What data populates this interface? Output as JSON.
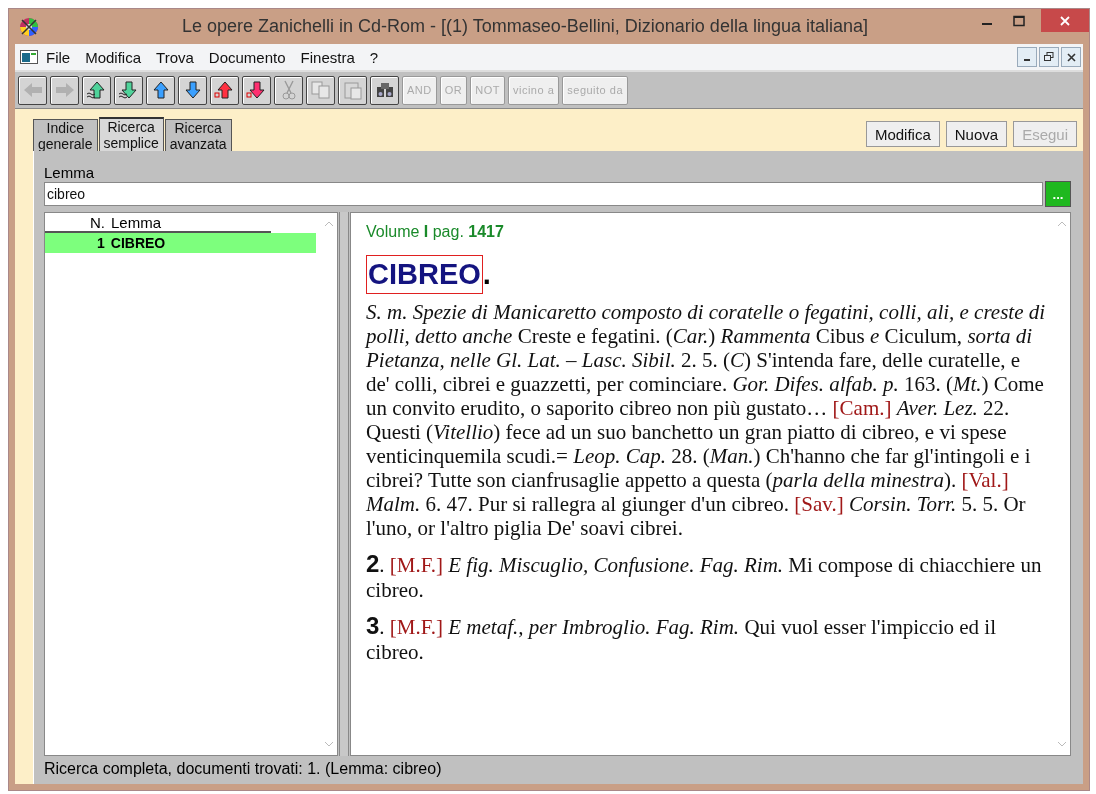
{
  "window": {
    "title": "Le opere Zanichelli in Cd-Rom - [(1) Tommaseo-Bellini, Dizionario della lingua italiana]"
  },
  "menu": [
    "File",
    "Modifica",
    "Trova",
    "Documento",
    "Finestra",
    "?"
  ],
  "toolbar": [
    {
      "kind": "back",
      "disabled": true
    },
    {
      "kind": "forward",
      "disabled": true
    },
    {
      "kind": "upwavy",
      "disabled": false
    },
    {
      "kind": "downwavy",
      "disabled": false
    },
    {
      "kind": "up",
      "disabled": false
    },
    {
      "kind": "down",
      "disabled": false
    },
    {
      "kind": "upred",
      "disabled": false
    },
    {
      "kind": "downred",
      "disabled": false
    },
    {
      "kind": "cut",
      "disabled": true
    },
    {
      "kind": "copy",
      "disabled": true
    },
    {
      "kind": "paste",
      "disabled": true
    },
    {
      "kind": "find",
      "disabled": false
    },
    {
      "kind": "text",
      "label": "AND",
      "disabled": true
    },
    {
      "kind": "text",
      "label": "OR",
      "disabled": true
    },
    {
      "kind": "text",
      "label": "NOT",
      "disabled": true
    },
    {
      "kind": "text",
      "label": "vicino a",
      "disabled": true
    },
    {
      "kind": "text",
      "label": "seguito da",
      "disabled": true
    }
  ],
  "tabs": [
    {
      "label": "Indice\ngenerale",
      "selected": false
    },
    {
      "label": "Ricerca\nsemplice",
      "selected": true
    },
    {
      "label": "Ricerca\navanzata",
      "selected": false
    }
  ],
  "actions": [
    {
      "label": "Modifica",
      "disabled": false
    },
    {
      "label": "Nuova",
      "disabled": false
    },
    {
      "label": "Esegui",
      "disabled": true
    }
  ],
  "lemma_field": {
    "label": "Lemma",
    "value": "cibreo",
    "button": "..."
  },
  "results": {
    "columns": [
      "N.",
      "Lemma"
    ],
    "rows": [
      {
        "n": "1",
        "lemma": "CIBREO",
        "selected": true
      }
    ]
  },
  "entry": {
    "volume": "Volume **I** pag. **1417**",
    "headword": "CIBREO",
    "headword_end": ".",
    "paragraphs": [
      [
        {
          "kind": "text",
          "text": "*S. m. Spezie di Manicaretto composto di coratelle o fegatini, colli, ali, e creste di polli, detto anche* Creste e fegatini. (*Car.*) *Rammenta* Cibus *e* Ciculum, *sorta di Pietanza, nelle Gl. Lat. – Lasc. Sibil.* 2. 5. (*C*) S'intenda fare, delle curatelle, e de' colli, cibrei e guazzetti, per cominciare. *Gor. Difes. alfab. p.* 163. (*Mt.*) Come un convito erudito, o saporito cibreo non più gustato… "
        },
        {
          "kind": "ref",
          "text": "[Cam.]"
        },
        {
          "kind": "text",
          "text": " *Aver. Lez.* 22. Questi (*Vitellio*) fece ad un suo banchetto un gran piatto di cibreo, e vi spese venticinquemila scudi.= *Leop. Cap.* 28. (*Man.*) Ch'hanno che far gl'intingoli e i cibrei? Tutte son cianfrusaglie appetto a questa (*parla della minestra*). "
        },
        {
          "kind": "ref",
          "text": "[Val.]"
        },
        {
          "kind": "text",
          "text": " *Malm.* 6. 47. Pur si rallegra al giunger d'un cibreo. "
        },
        {
          "kind": "ref",
          "text": "[Sav.]"
        },
        {
          "kind": "text",
          "text": " *Corsin. Torr.* 5. 5. Or l'uno, or l'altro piglia De' soavi cibrei."
        }
      ],
      [
        {
          "kind": "num",
          "text": "2"
        },
        {
          "kind": "text",
          "text": ". "
        },
        {
          "kind": "ref",
          "text": "[M.F.]"
        },
        {
          "kind": "text",
          "text": " *E fig. Miscuglio, Confusione. Fag. Rim.* Mi compose di chiacchiere un cibreo."
        }
      ],
      [
        {
          "kind": "num",
          "text": "3"
        },
        {
          "kind": "text",
          "text": ". "
        },
        {
          "kind": "ref",
          "text": "[M.F.]"
        },
        {
          "kind": "text",
          "text": " *E metaf., per Imbroglio. Fag. Rim.* Qui vuol esser l'impiccio ed il cibreo."
        }
      ]
    ]
  },
  "status_bar": "Ricerca completa, documenti trovati: 1. (Lemma: cibreo)"
}
